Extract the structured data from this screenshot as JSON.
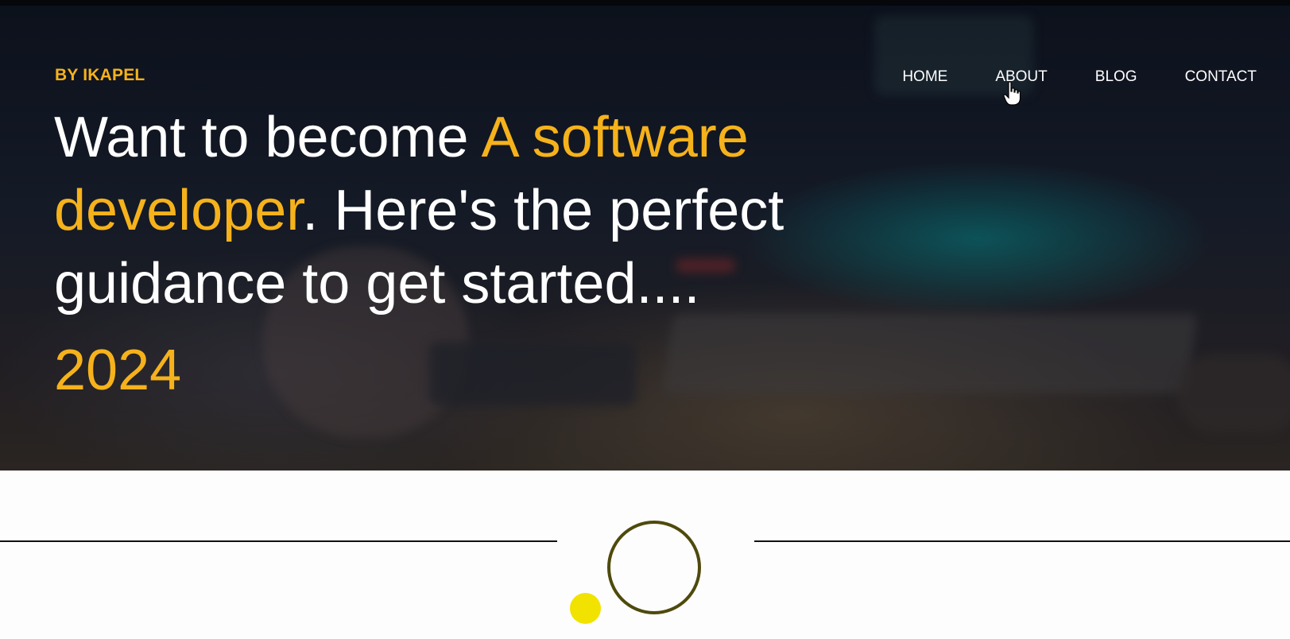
{
  "brand": {
    "label": "BY IKAPEL"
  },
  "nav": {
    "items": [
      {
        "label": "HOME"
      },
      {
        "label": "ABOUT"
      },
      {
        "label": "BLOG"
      },
      {
        "label": "CONTACT"
      }
    ]
  },
  "hero": {
    "headline": {
      "part1": "Want to become ",
      "accent": "A software developer",
      "part2": ". Here's the perfect guidance to get started...."
    },
    "year": "2024"
  },
  "colors": {
    "accent": "#f6b21b",
    "nav_text": "#ffffff",
    "ring": "#4f4a0c",
    "dot": "#f2e200"
  },
  "icons": {
    "cursor": "hand-pointer-icon"
  }
}
